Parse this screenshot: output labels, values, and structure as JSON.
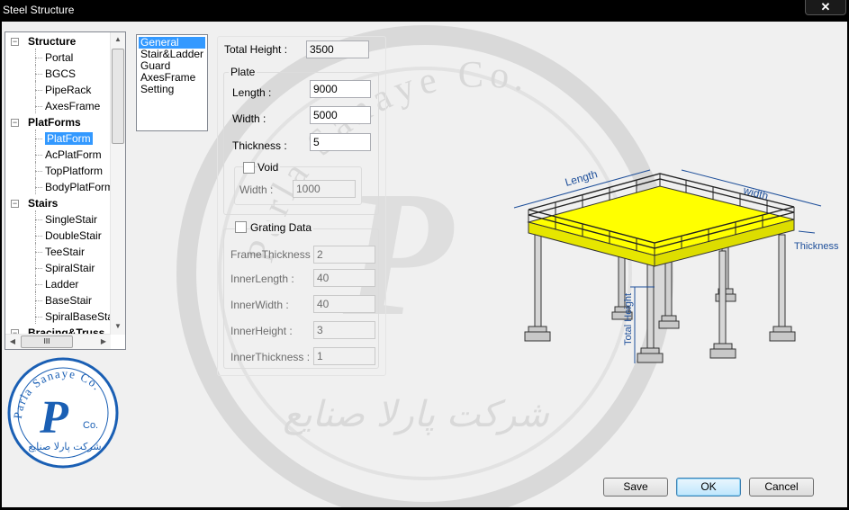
{
  "window": {
    "title": "Steel Structure",
    "close_glyph": "✕"
  },
  "tree": {
    "scroll_glyph_h": "III",
    "items": [
      {
        "label": "Structure",
        "type": "category"
      },
      {
        "label": "Portal",
        "type": "leaf"
      },
      {
        "label": "BGCS",
        "type": "leaf"
      },
      {
        "label": "PipeRack",
        "type": "leaf"
      },
      {
        "label": "AxesFrame",
        "type": "leaf"
      },
      {
        "label": "PlatForms",
        "type": "category"
      },
      {
        "label": "PlatForm",
        "type": "leaf",
        "selected": true
      },
      {
        "label": "AcPlatForm",
        "type": "leaf"
      },
      {
        "label": "TopPlatform",
        "type": "leaf"
      },
      {
        "label": "BodyPlatForm",
        "type": "leaf"
      },
      {
        "label": "Stairs",
        "type": "category"
      },
      {
        "label": "SingleStair",
        "type": "leaf"
      },
      {
        "label": "DoubleStair",
        "type": "leaf"
      },
      {
        "label": "TeeStair",
        "type": "leaf"
      },
      {
        "label": "SpiralStair",
        "type": "leaf"
      },
      {
        "label": "Ladder",
        "type": "leaf"
      },
      {
        "label": "BaseStair",
        "type": "leaf"
      },
      {
        "label": "SpiralBaseStair",
        "type": "leaf"
      },
      {
        "label": "Bracing&Truss",
        "type": "category"
      }
    ]
  },
  "tabs_list": [
    "General",
    "Stair&Ladder Guard",
    "AxesFrame",
    "Setting"
  ],
  "tabs_display": [
    "General",
    "Stair&Ladder",
    "Guard",
    "AxesFrame",
    "Setting"
  ],
  "form": {
    "total_height_label": "Total Height :",
    "total_height_value": "3500",
    "plate_group": "Plate",
    "length_label": "Length :",
    "length_value": "9000",
    "width_label": "Width :",
    "width_value": "5000",
    "thickness_label": "Thickness :",
    "thickness_value": "5",
    "void_label": "Void",
    "void_checked": false,
    "void_width_label": "Width :",
    "void_width_value": "1000",
    "grating_label": "Grating Data",
    "grating_checked": false,
    "frame_thickness_label": "FrameThickness :",
    "frame_thickness_value": "2",
    "inner_length_label": "InnerLength :",
    "inner_length_value": "40",
    "inner_width_label": "InnerWidth :",
    "inner_width_value": "40",
    "inner_height_label": "InnerHeight :",
    "inner_height_value": "3",
    "inner_thickness_label": "InnerThickness :",
    "inner_thickness_value": "1"
  },
  "diagram": {
    "length_label": "Length",
    "width_label": "width",
    "thickness_label": "Thickness",
    "total_height_label": "Total Height",
    "deck_color": "#ffff00"
  },
  "logo": {
    "text_en": "Parla Sanaye Co.",
    "text_fa": "شرکت پارلا صنایع",
    "mark": "P",
    "mark_suffix": "Co.",
    "color": "#1a5fb4"
  },
  "watermark": {
    "text_en": "Parla Sanaye Co.",
    "text_fa": "شرکت پارلا صنایع"
  },
  "buttons": {
    "save": "Save",
    "ok": "OK",
    "cancel": "Cancel"
  }
}
